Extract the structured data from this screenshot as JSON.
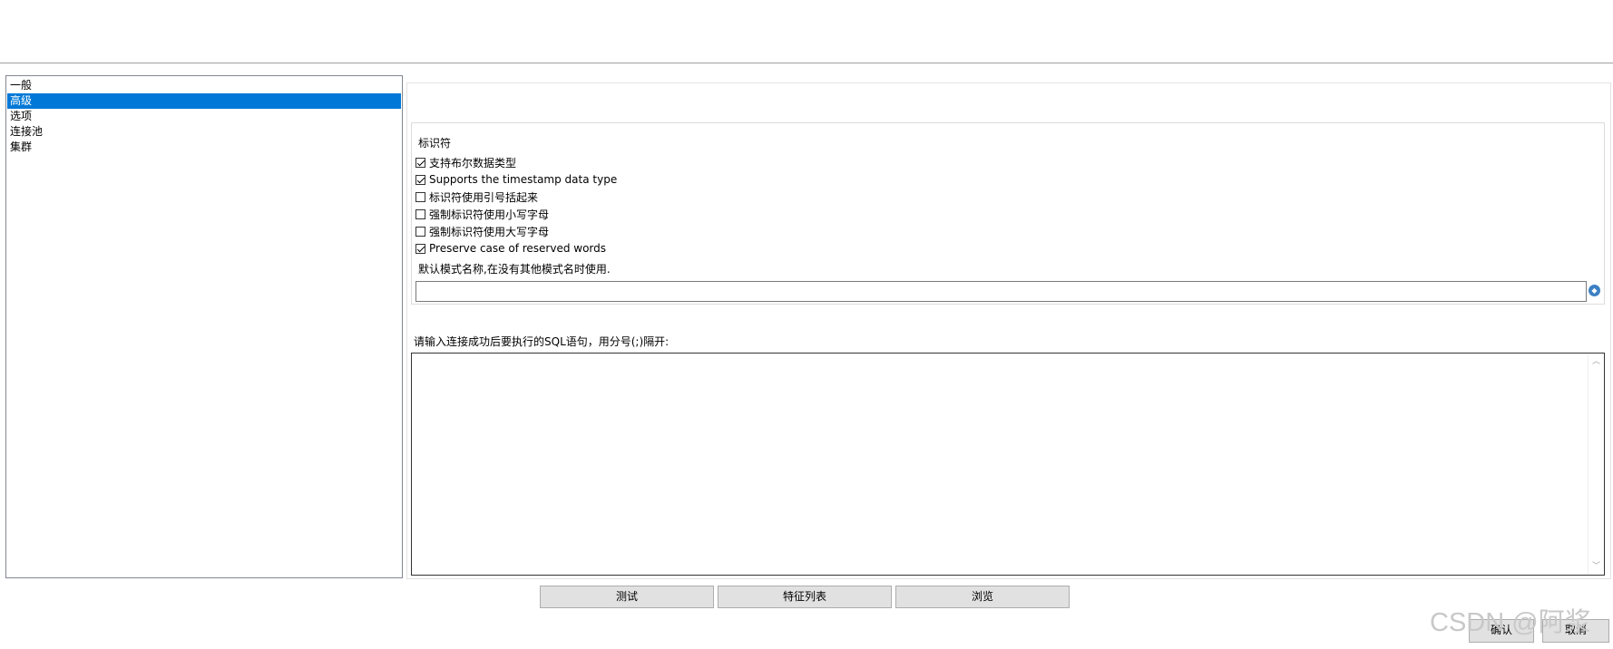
{
  "nav": {
    "items": [
      {
        "label": "一般"
      },
      {
        "label": "高级"
      },
      {
        "label": "选项"
      },
      {
        "label": "连接池"
      },
      {
        "label": "集群"
      }
    ],
    "selected_index": 1
  },
  "identifier_group": {
    "title": "标识符",
    "options": [
      {
        "label": "支持布尔数据类型",
        "checked": true
      },
      {
        "label": "Supports the timestamp data type",
        "checked": true
      },
      {
        "label": "标识符使用引号括起来",
        "checked": false
      },
      {
        "label": "强制标识符使用小写字母",
        "checked": false
      },
      {
        "label": "强制标识符使用大写字母",
        "checked": false
      },
      {
        "label": "Preserve case of reserved words",
        "checked": true
      }
    ],
    "schema_label": "默认模式名称,在没有其他模式名时使用.",
    "schema_value": ""
  },
  "sql": {
    "label": "请输入连接成功后要执行的SQL语句，用分号(;)隔开:",
    "value": ""
  },
  "buttons": {
    "test": "测试",
    "features": "特征列表",
    "browse": "浏览",
    "ok": "确认",
    "cancel": "取消"
  },
  "watermark": "CSDN @阿浆"
}
